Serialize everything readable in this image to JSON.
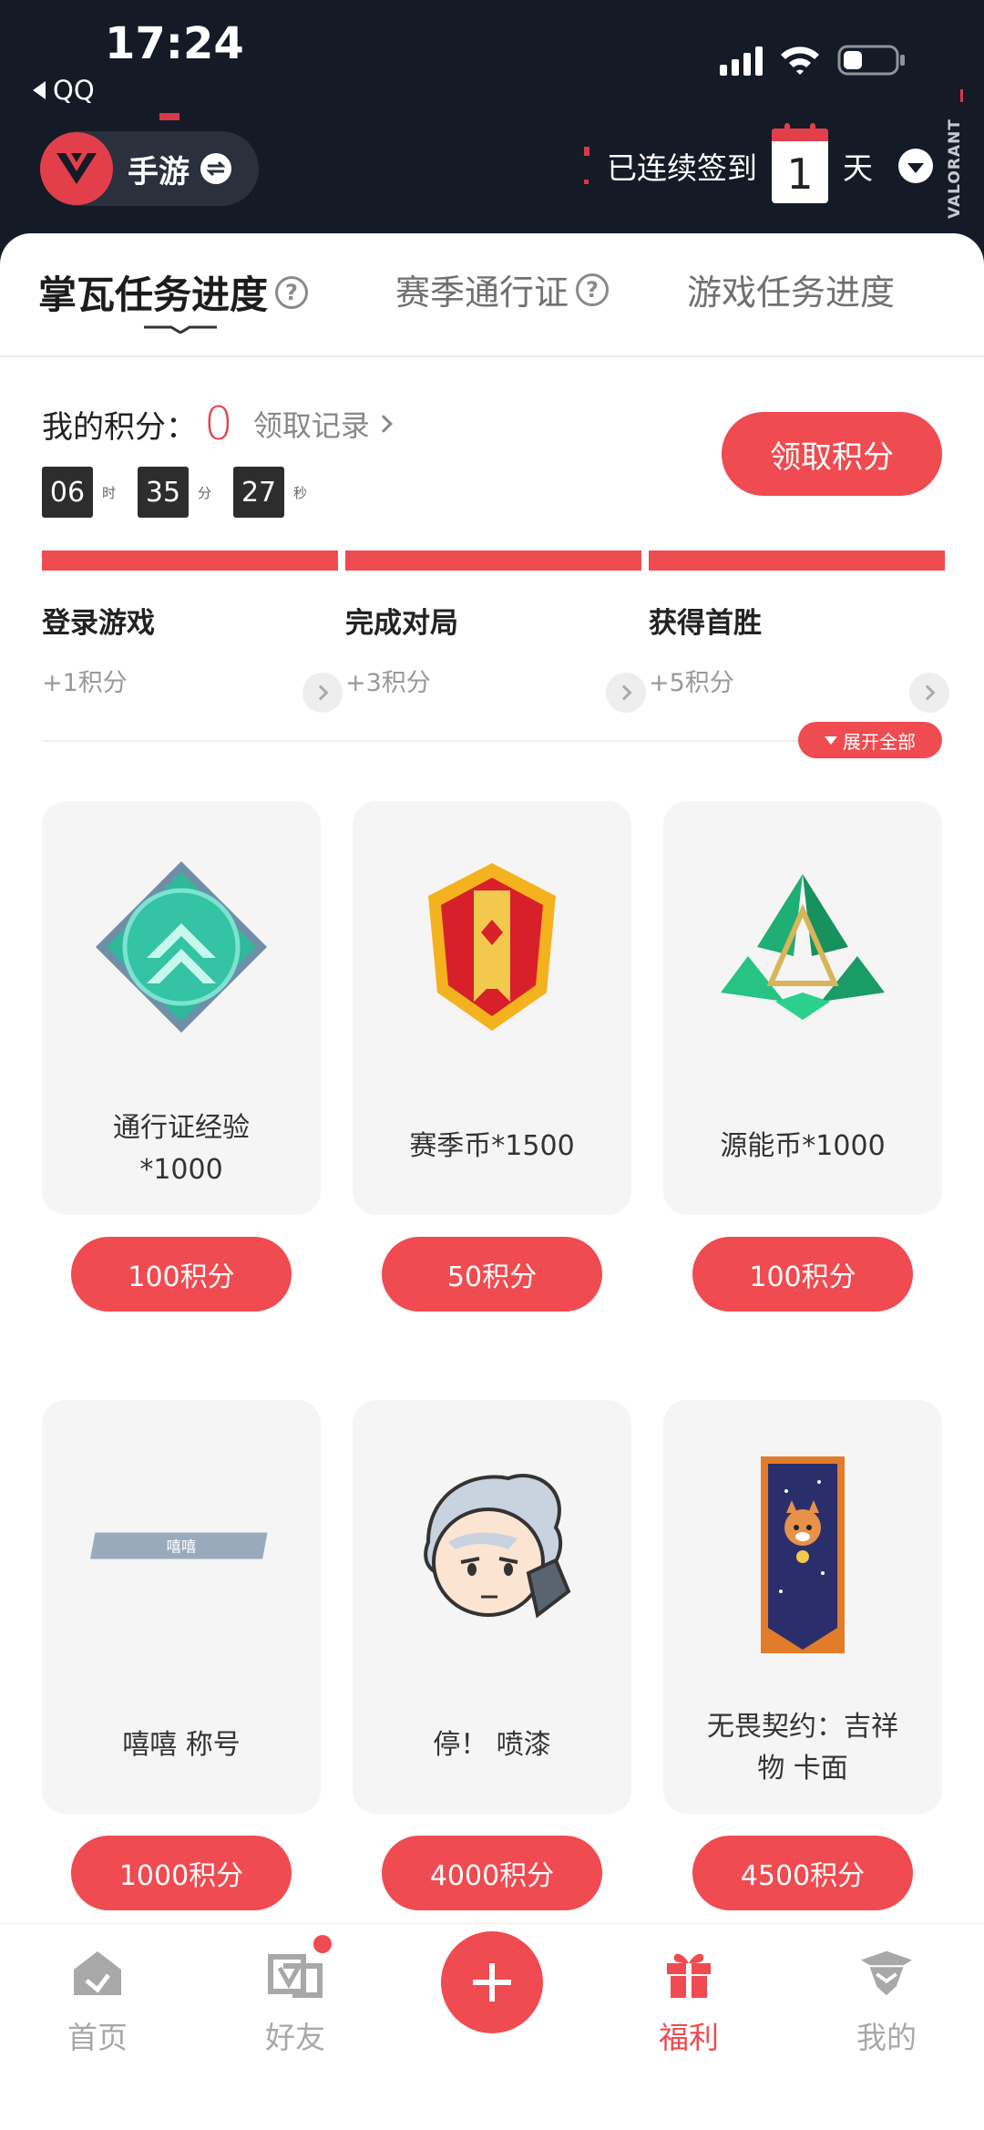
{
  "status_bar": {
    "time": "17:24",
    "back_label": "QQ"
  },
  "header": {
    "game_label": "手游",
    "checkin_prefix": "已连续签到",
    "checkin_days": "1",
    "checkin_unit": "天",
    "side_brand": "VALORANT"
  },
  "tabs": [
    {
      "label": "掌瓦任务进度",
      "active": true
    },
    {
      "label": "赛季通行证",
      "active": false
    },
    {
      "label": "游戏任务进度",
      "active": false
    }
  ],
  "points": {
    "label": "我的积分：",
    "value": "0",
    "records_label": "领取记录",
    "claim_button": "领取积分"
  },
  "timer": {
    "hours": "06",
    "hours_unit": "时",
    "minutes": "35",
    "minutes_unit": "分",
    "seconds": "27",
    "seconds_unit": "秒"
  },
  "tasks": [
    {
      "title": "登录游戏",
      "reward": "+1积分"
    },
    {
      "title": "完成对局",
      "reward": "+3积分"
    },
    {
      "title": "获得首胜",
      "reward": "+5积分"
    }
  ],
  "expand_label": "展开全部",
  "items": [
    {
      "name": "通行证经验\n*1000",
      "price": "100积分",
      "icon": "pass-xp-icon"
    },
    {
      "name": "赛季币*1500",
      "price": "50积分",
      "icon": "season-coin-icon"
    },
    {
      "name": "源能币*1000",
      "price": "100积分",
      "icon": "radianite-icon"
    },
    {
      "name": "嘻嘻 称号",
      "price": "1000积分",
      "icon": "title-card-icon",
      "banner_text": "嘻嘻"
    },
    {
      "name": "停！ 喷漆",
      "price": "4000积分",
      "icon": "spray-icon"
    },
    {
      "name": "无畏契约：吉祥\n物 卡面",
      "price": "4500积分",
      "icon": "player-card-icon"
    }
  ],
  "bottom_nav": [
    {
      "label": "首页",
      "active": false,
      "icon": "home-icon"
    },
    {
      "label": "好友",
      "active": false,
      "icon": "friends-icon"
    },
    {
      "label": "福利",
      "active": true,
      "icon": "gift-icon"
    },
    {
      "label": "我的",
      "active": false,
      "icon": "profile-icon"
    }
  ],
  "colors": {
    "accent": "#ef4b50",
    "header_bg": "#141a26"
  }
}
